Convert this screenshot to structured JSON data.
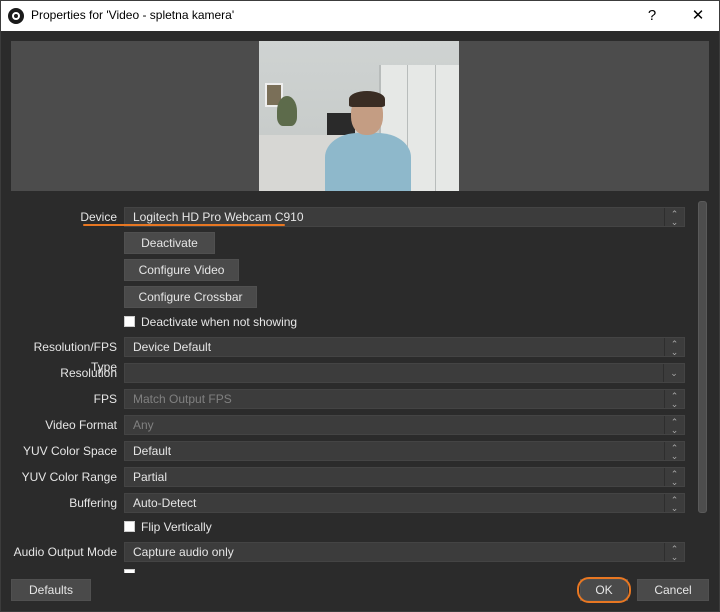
{
  "window": {
    "title": "Properties for 'Video - spletna kamera'",
    "help_glyph": "?",
    "close_glyph": "✕"
  },
  "form": {
    "device": {
      "label": "Device",
      "value": "Logitech HD Pro Webcam C910"
    },
    "deactivate_button": "Deactivate",
    "configure_video_button": "Configure Video",
    "configure_crossbar_button": "Configure Crossbar",
    "deactivate_when_not_showing": {
      "label": "Deactivate when not showing",
      "checked": false
    },
    "resolution_fps_type": {
      "label": "Resolution/FPS Type",
      "value": "Device Default"
    },
    "resolution": {
      "label": "Resolution",
      "value": ""
    },
    "fps": {
      "label": "FPS",
      "value": "Match Output FPS"
    },
    "video_format": {
      "label": "Video Format",
      "value": "Any"
    },
    "yuv_color_space": {
      "label": "YUV Color Space",
      "value": "Default"
    },
    "yuv_color_range": {
      "label": "YUV Color Range",
      "value": "Partial"
    },
    "buffering": {
      "label": "Buffering",
      "value": "Auto-Detect"
    },
    "flip_vertically": {
      "label": "Flip Vertically",
      "checked": false
    },
    "audio_output_mode": {
      "label": "Audio Output Mode",
      "value": "Capture audio only"
    }
  },
  "footer": {
    "defaults": "Defaults",
    "ok": "OK",
    "cancel": "Cancel"
  },
  "icons": {
    "spin": "⌃⌄",
    "down": "⌄"
  },
  "colors": {
    "highlight": "#e87722",
    "background": "#2b2b2b",
    "control": "#3c3c3c",
    "button": "#4a4a4a"
  }
}
